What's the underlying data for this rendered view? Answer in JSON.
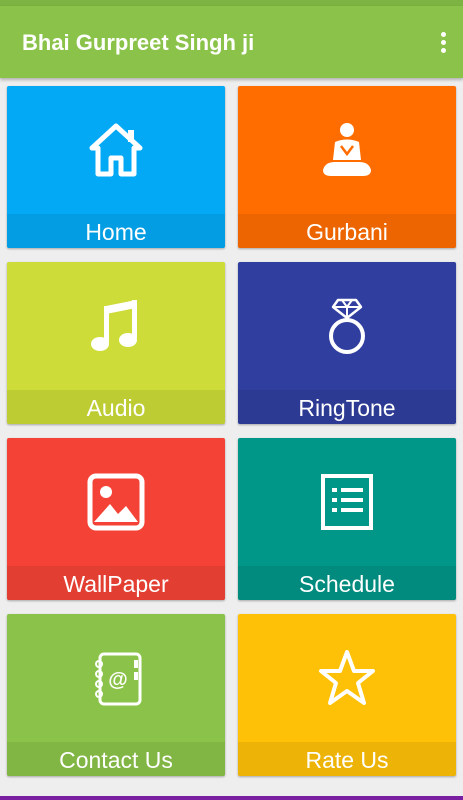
{
  "app": {
    "title": "Bhai Gurpreet Singh ji"
  },
  "colors": {
    "appbar": "#8bc34a",
    "background": "#eeeeee"
  },
  "tiles": [
    {
      "label": "Home",
      "icon": "home-icon",
      "color": "#03a9f4"
    },
    {
      "label": "Gurbani",
      "icon": "meditation-icon",
      "color": "#ff6d00"
    },
    {
      "label": "Audio",
      "icon": "music-note-icon",
      "color": "#cddc39"
    },
    {
      "label": "RingTone",
      "icon": "ring-icon",
      "color": "#303f9f"
    },
    {
      "label": "WallPaper",
      "icon": "image-icon",
      "color": "#f44336"
    },
    {
      "label": "Schedule",
      "icon": "list-icon",
      "color": "#009688"
    },
    {
      "label": "Contact Us",
      "icon": "contact-book-icon",
      "color": "#8bc34a"
    },
    {
      "label": "Rate Us",
      "icon": "star-icon",
      "color": "#ffc107"
    }
  ]
}
